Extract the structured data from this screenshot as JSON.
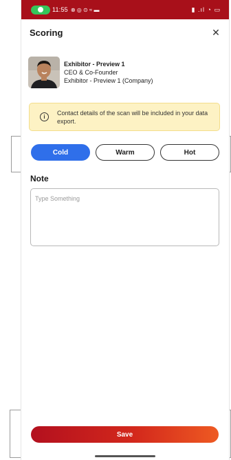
{
  "status_bar": {
    "time": "11:55",
    "left_icons_text": "⊗ ◎ ⊙ ≈ ▬",
    "right_icons_text": "▮ .ıl ◔ ▭",
    "background_color": "#a8101a"
  },
  "header": {
    "title": "Scoring",
    "close_icon": "close-icon"
  },
  "profile": {
    "name": "Exhibitor - Preview 1",
    "role": "CEO & Co-Founder",
    "company": "Exhibitor - Preview 1 (Company)"
  },
  "info_banner": {
    "icon": "info-icon",
    "text": "Contact details of the scan will be included in your data export."
  },
  "scoring": {
    "options": [
      {
        "label": "Cold",
        "selected": true
      },
      {
        "label": "Warm",
        "selected": false
      },
      {
        "label": "Hot",
        "selected": false
      }
    ],
    "selected_color": "#2f6fea"
  },
  "note": {
    "label": "Note",
    "placeholder": "Type Something",
    "value": ""
  },
  "footer": {
    "save_label": "Save",
    "accent_start": "#b3101e",
    "accent_end": "#ee5a22"
  }
}
